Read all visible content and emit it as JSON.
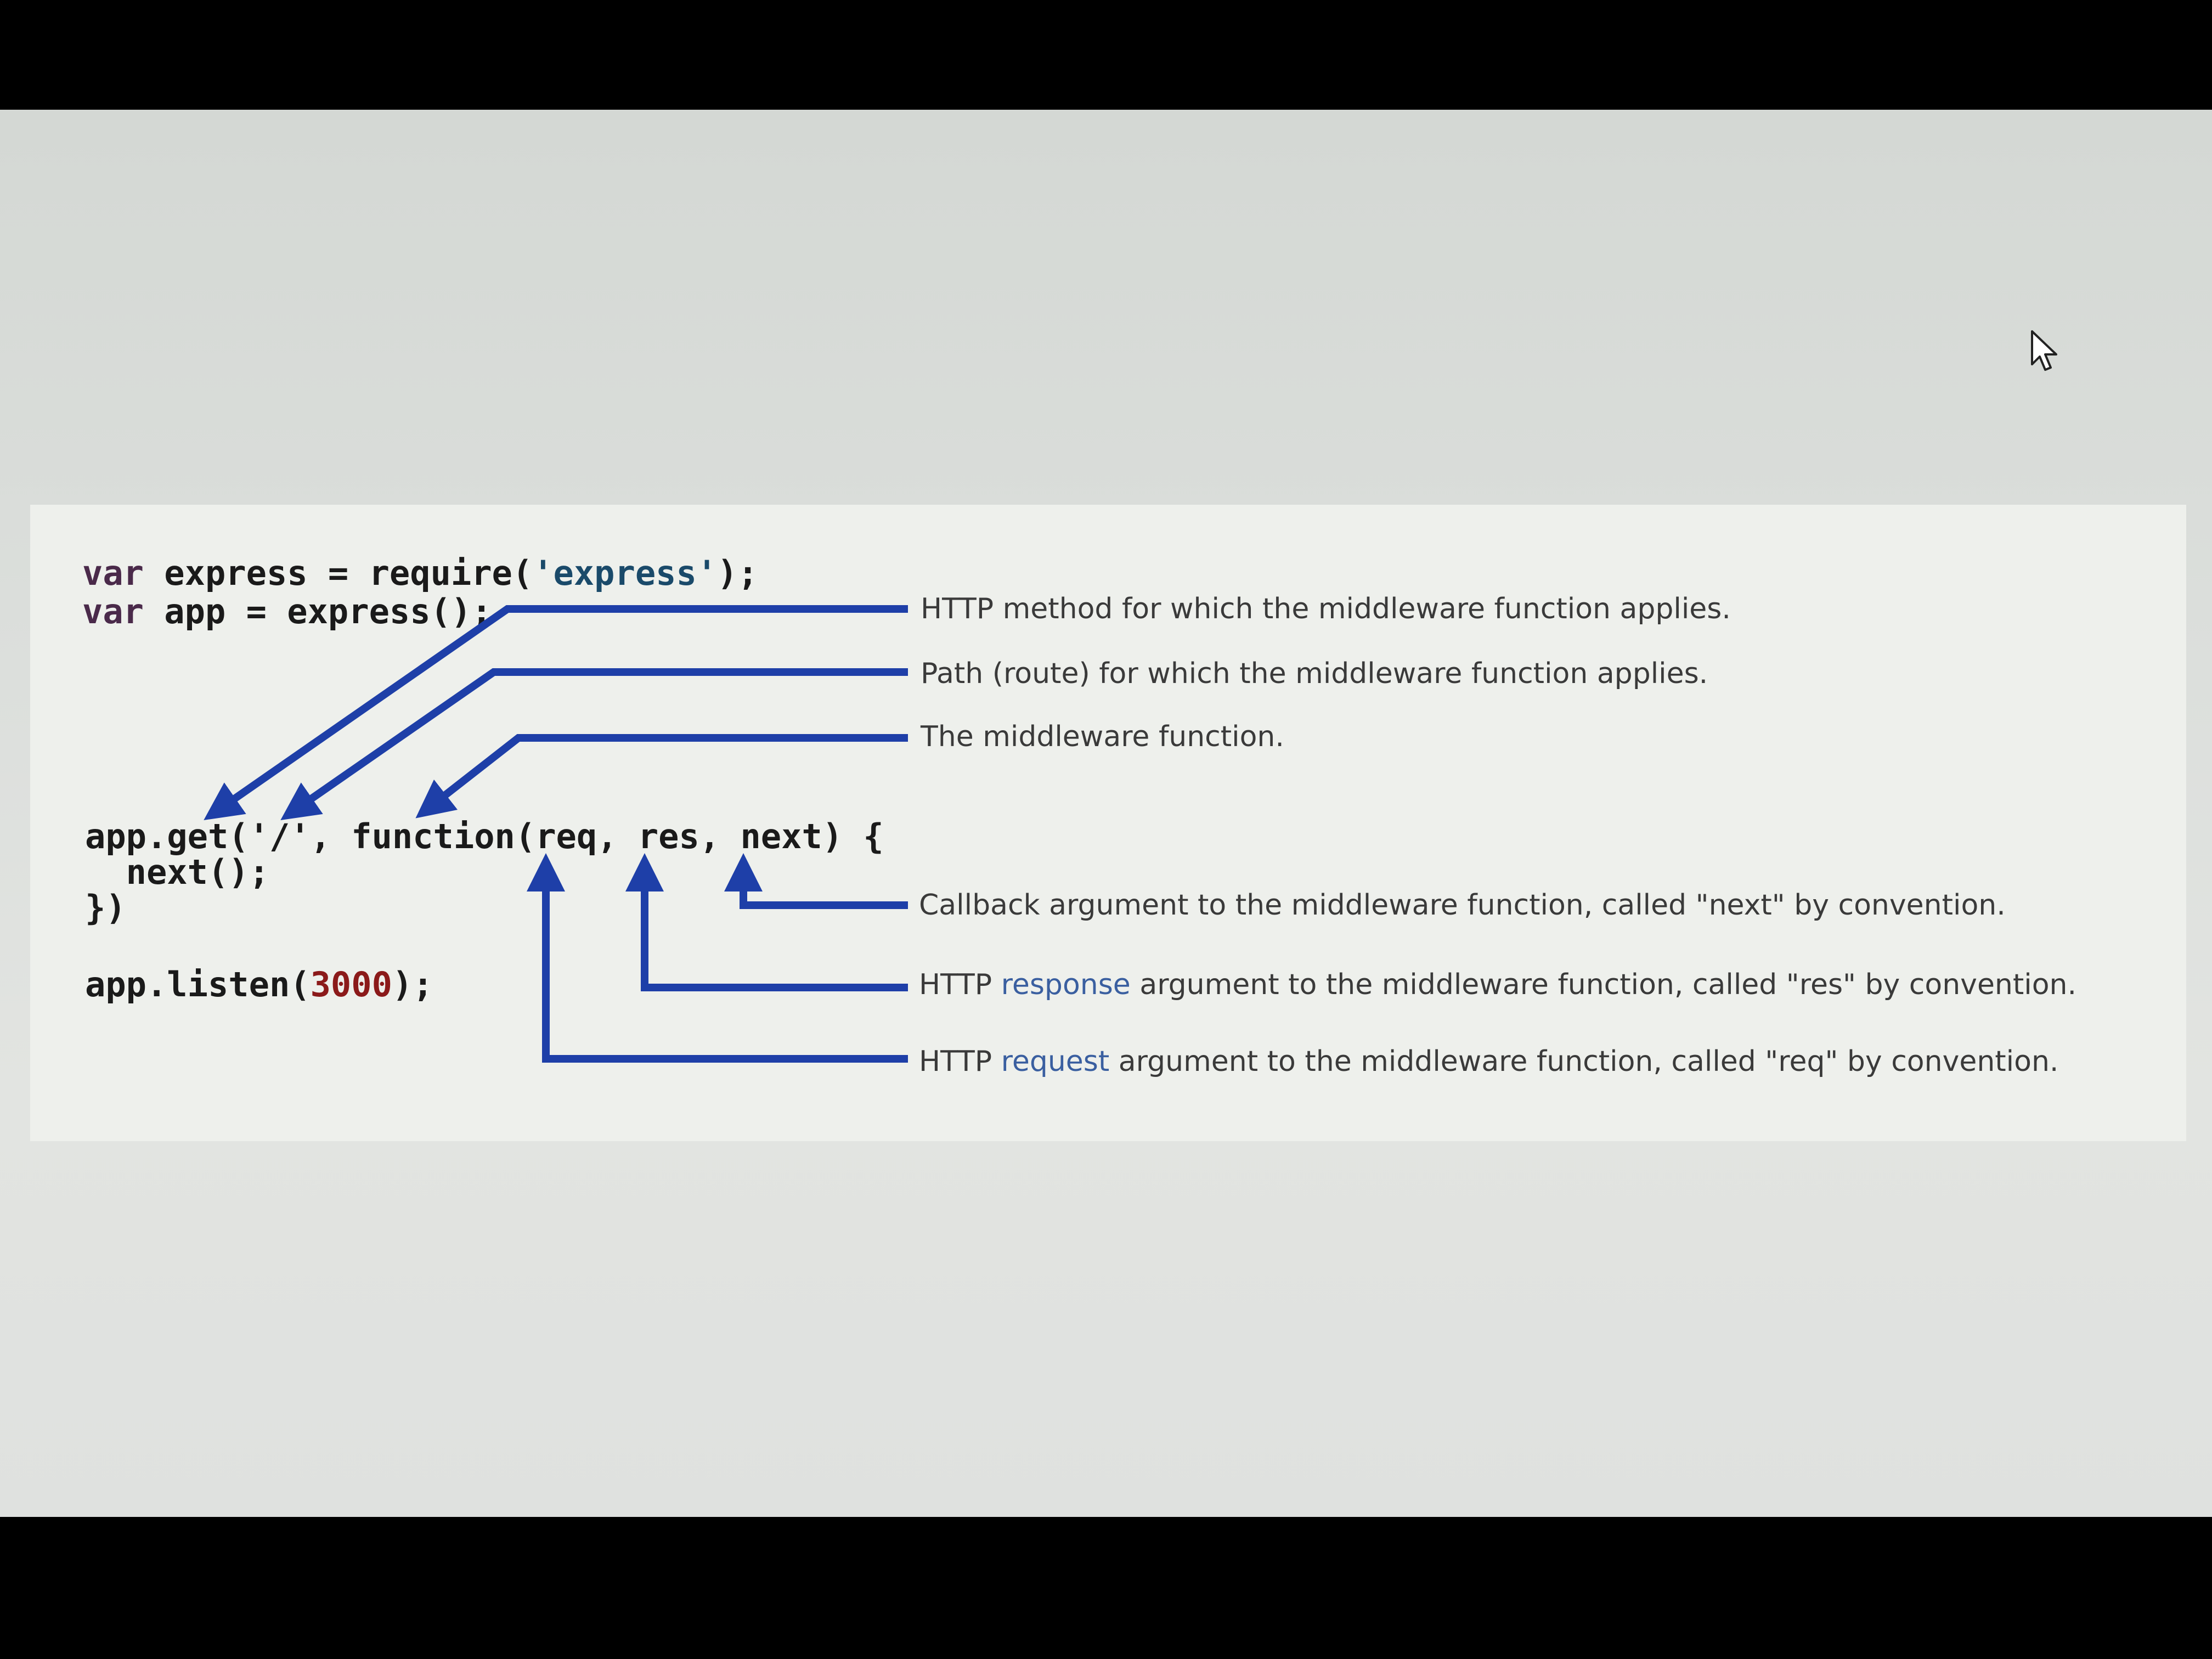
{
  "code": {
    "line1_kw": "var",
    "line1_rest": " express = require(",
    "line1_str": "'express'",
    "line1_end": ");",
    "line2_kw": "var",
    "line2_rest": " app = express();",
    "line3": "app.get('/', function(req, res, next) {",
    "line4": "  next();",
    "line5": "})",
    "line6_pre": "app.listen(",
    "line6_num": "3000",
    "line6_end": ");"
  },
  "annotations": {
    "method": "HTTP method for which the middleware function applies.",
    "path": "Path (route) for which the middleware function applies.",
    "function": "The middleware function.",
    "next": "Callback argument to the middleware function, called \"next\" by convention.",
    "res_pre": "HTTP ",
    "res_hl": "response",
    "res_post": " argument to the middleware function, called \"res\" by convention.",
    "req_pre": "HTTP ",
    "req_hl": "request",
    "req_post": " argument to the middleware function, called \"req\" by convention."
  },
  "colors": {
    "arrow": "#1e3fa8",
    "highlight": "#3a5fa0"
  },
  "icons": {
    "cursor": "mouse-pointer-icon"
  }
}
